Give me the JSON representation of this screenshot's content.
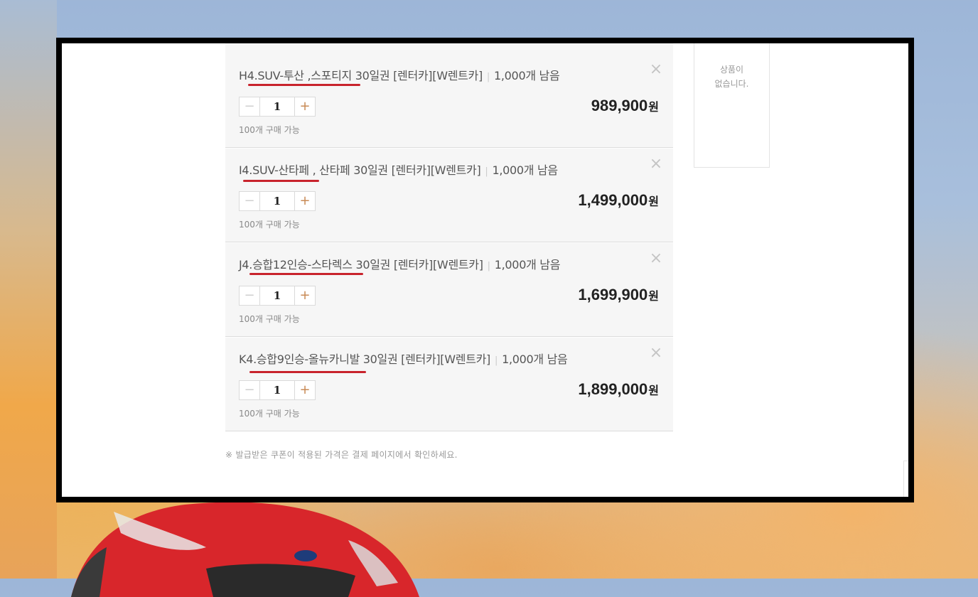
{
  "cart": {
    "items": [
      {
        "title": "H4.SUV-투산 ,스포티지 30일권 [렌터카][W렌트카]",
        "stock": "1,000개 남음",
        "quantity": "1",
        "limit": "100개 구매 가능",
        "price": "989,900",
        "price_unit": "원",
        "minus_label": "−",
        "plus_label": "+",
        "close_label": "×"
      },
      {
        "title": "I4.SUV-산타페 , 산타페 30일권 [렌터카][W렌트카]",
        "stock": "1,000개 남음",
        "quantity": "1",
        "limit": "100개 구매 가능",
        "price": "1,499,000",
        "price_unit": "원",
        "minus_label": "−",
        "plus_label": "+",
        "close_label": "×"
      },
      {
        "title": "J4.승합12인승-스타렉스 30일권 [렌터카][W렌트카]",
        "stock": "1,000개 남음",
        "quantity": "1",
        "limit": "100개 구매 가능",
        "price": "1,699,900",
        "price_unit": "원",
        "minus_label": "−",
        "plus_label": "+",
        "close_label": "×"
      },
      {
        "title": "K4.승합9인승-올뉴카니발 30일권 [렌터카][W렌트카]",
        "stock": "1,000개 남음",
        "quantity": "1",
        "limit": "100개 구매 가능",
        "price": "1,899,000",
        "price_unit": "원",
        "minus_label": "−",
        "plus_label": "+",
        "close_label": "×"
      }
    ],
    "notice": "※ 발급받은 쿠폰이 적용된 가격은 결제 페이지에서 확인하세요."
  },
  "sidebar": {
    "empty_message": "상품이\n없습니다."
  },
  "colors": {
    "underline": "#c8232c",
    "frame": "#000000",
    "item_bg": "#f6f6f6"
  }
}
